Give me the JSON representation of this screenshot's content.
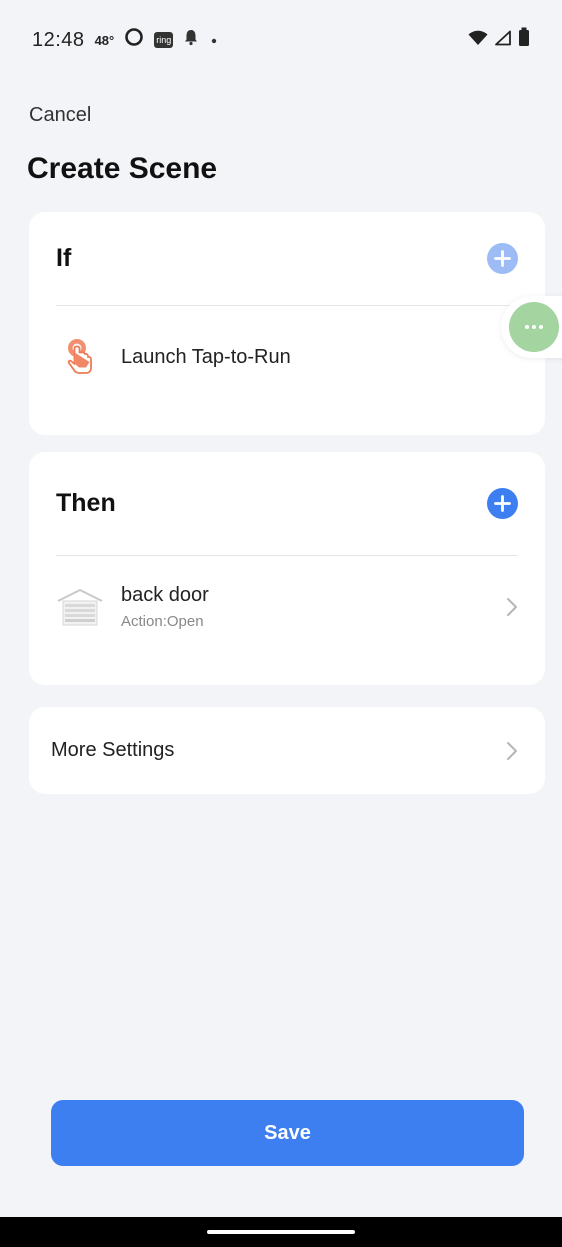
{
  "status_bar": {
    "time": "12:48",
    "temperature": "48°",
    "ring_badge": "ring"
  },
  "header": {
    "cancel_label": "Cancel",
    "title": "Create Scene"
  },
  "if_section": {
    "title": "If",
    "condition": {
      "label": "Launch Tap-to-Run",
      "icon": "tap-hand-icon"
    }
  },
  "then_section": {
    "title": "Then",
    "action": {
      "device_name": "back door",
      "detail": "Action:Open",
      "icon": "garage-door-icon"
    }
  },
  "more_settings": {
    "label": "More Settings"
  },
  "save_label": "Save",
  "colors": {
    "accent": "#3d7ff0",
    "accent_light": "#9dbcf6",
    "float_green": "#a4d4a0",
    "tap_icon": "#ee7b55"
  }
}
